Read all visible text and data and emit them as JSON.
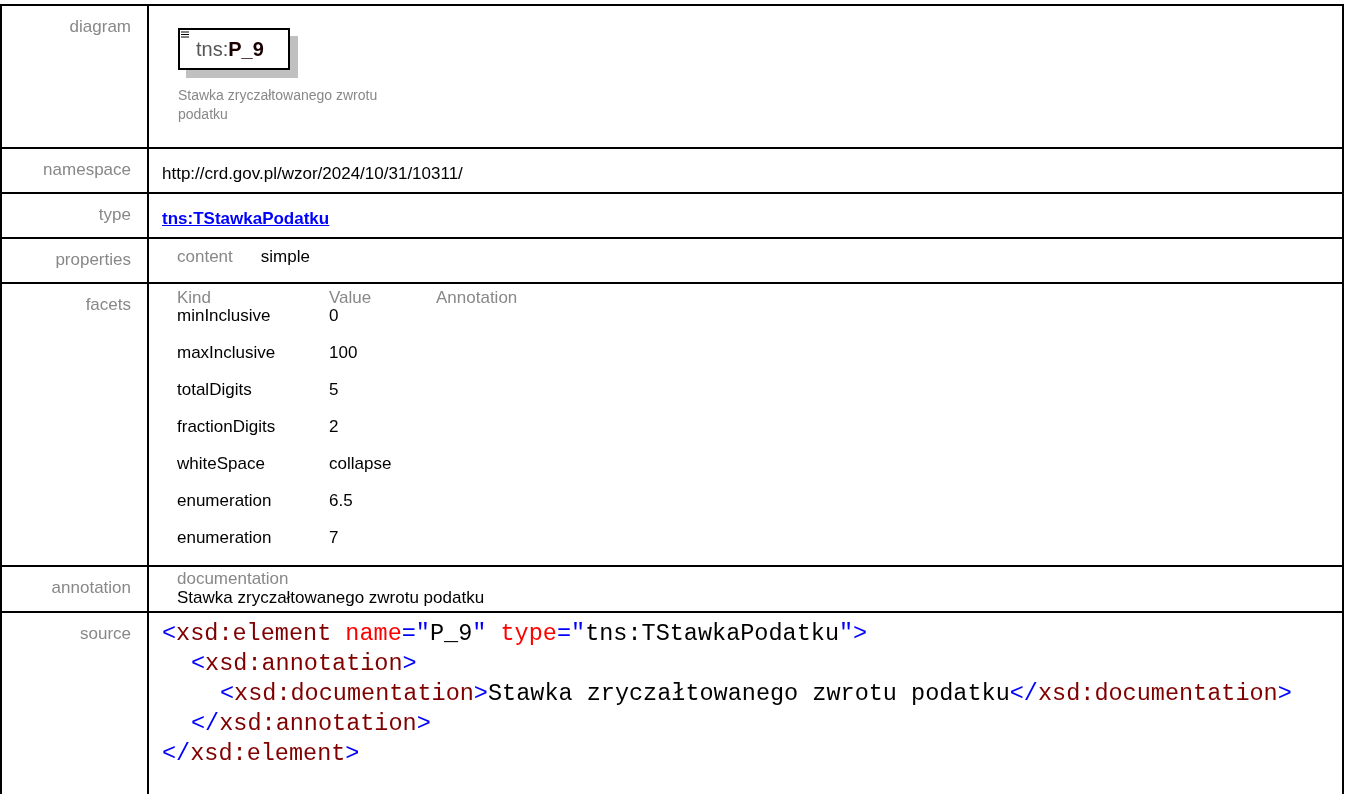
{
  "diagram": {
    "label": "diagram",
    "prefix": "tns:",
    "name": "P_9",
    "caption": "Stawka zryczałtowanego zwrotu podatku"
  },
  "namespace": {
    "label": "namespace",
    "value": "http://crd.gov.pl/wzor/2024/10/31/10311/"
  },
  "type": {
    "label": "type",
    "link": "tns:TStawkaPodatku"
  },
  "properties": {
    "label": "properties",
    "items": [
      {
        "key": "content",
        "value": "simple"
      }
    ]
  },
  "facets": {
    "label": "facets",
    "columns": [
      "Kind",
      "Value",
      "Annotation"
    ],
    "rows": [
      {
        "kind": "minInclusive",
        "value": "0"
      },
      {
        "kind": "maxInclusive",
        "value": "100"
      },
      {
        "kind": "totalDigits",
        "value": "5"
      },
      {
        "kind": "fractionDigits",
        "value": "2"
      },
      {
        "kind": "whiteSpace",
        "value": "collapse"
      },
      {
        "kind": "enumeration",
        "value": "6.5"
      },
      {
        "kind": "enumeration",
        "value": "7"
      }
    ]
  },
  "annotation": {
    "label": "annotation",
    "heading": "documentation",
    "text": "Stawka zryczałtowanego zwrotu podatku"
  },
  "source": {
    "label": "source",
    "root": {
      "open": [
        {
          "kind": "punct",
          "text": "<"
        },
        {
          "kind": "tag",
          "text": "xsd:element"
        },
        {
          "kind": "attr",
          "text": " name"
        },
        {
          "kind": "punct",
          "text": "=\""
        },
        {
          "kind": "text",
          "text": "P_9"
        },
        {
          "kind": "punct",
          "text": "\""
        },
        {
          "kind": "attr",
          "text": " type"
        },
        {
          "kind": "punct",
          "text": "=\""
        },
        {
          "kind": "text",
          "text": "tns:TStawkaPodatku"
        },
        {
          "kind": "punct",
          "text": "\">"
        }
      ],
      "children": [
        {
          "open": [
            {
              "kind": "punct",
              "text": "<"
            },
            {
              "kind": "tag",
              "text": "xsd:annotation"
            },
            {
              "kind": "punct",
              "text": ">"
            }
          ],
          "children": [
            {
              "open": [
                {
                  "kind": "punct",
                  "text": "<"
                },
                {
                  "kind": "tag",
                  "text": "xsd:documentation"
                },
                {
                  "kind": "punct",
                  "text": ">"
                },
                {
                  "kind": "text",
                  "text": "Stawka zryczałtowanego zwrotu podatku"
                },
                {
                  "kind": "punct",
                  "text": "</"
                },
                {
                  "kind": "tag",
                  "text": "xsd:documentation"
                },
                {
                  "kind": "punct",
                  "text": ">"
                }
              ]
            }
          ],
          "close": [
            {
              "kind": "punct",
              "text": "</"
            },
            {
              "kind": "tag",
              "text": "xsd:annotation"
            },
            {
              "kind": "punct",
              "text": ">"
            }
          ]
        }
      ],
      "close": [
        {
          "kind": "punct",
          "text": "</"
        },
        {
          "kind": "tag",
          "text": "xsd:element"
        },
        {
          "kind": "punct",
          "text": ">"
        }
      ]
    }
  }
}
